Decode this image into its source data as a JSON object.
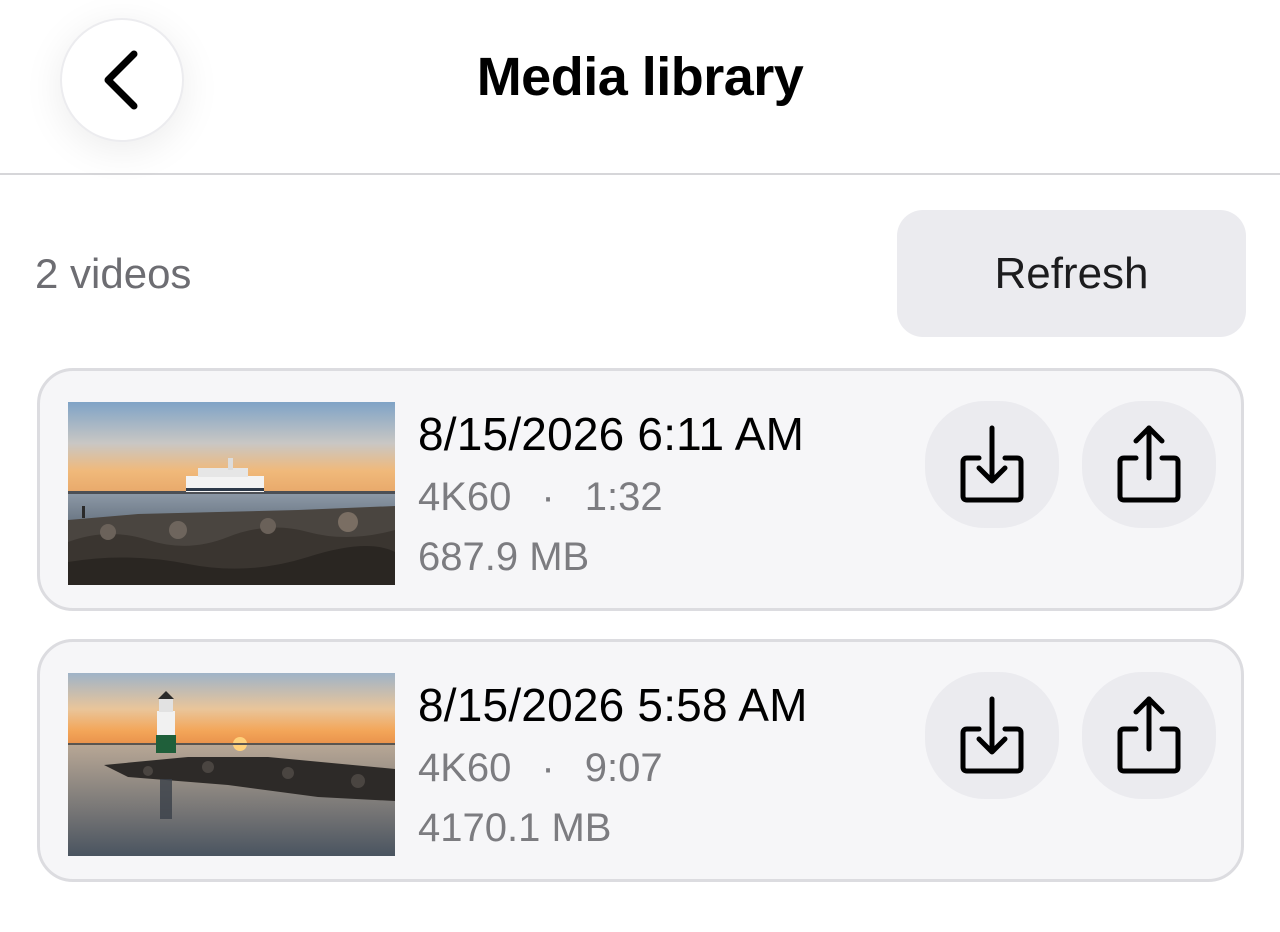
{
  "header": {
    "title": "Media library",
    "back_icon": "chevron-left-icon"
  },
  "toolbar": {
    "count_label": "2 videos",
    "refresh_label": "Refresh"
  },
  "videos": [
    {
      "date": "8/15/2026 6:11 AM",
      "quality": "4K60",
      "separator": "·",
      "duration": "1:32",
      "size": "687.9 MB",
      "thumbnail": "ferry-harbor-sunset"
    },
    {
      "date": "8/15/2026 5:58 AM",
      "quality": "4K60",
      "separator": "·",
      "duration": "9:07",
      "size": "4170.1 MB",
      "thumbnail": "lighthouse-pier-sunset"
    }
  ],
  "icons": {
    "download": "download-icon",
    "share": "share-icon"
  },
  "colors": {
    "button_bg": "#ebebef",
    "card_bg": "#f6f6f8",
    "secondary_text": "#7c7c80"
  }
}
